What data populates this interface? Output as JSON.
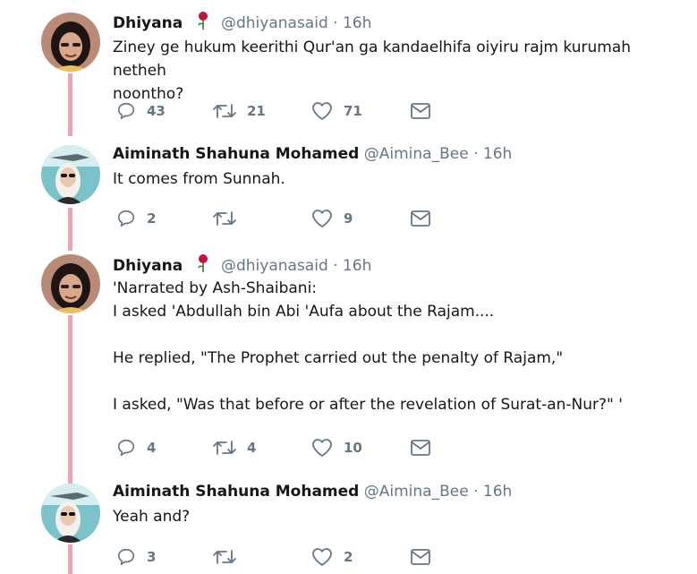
{
  "tweets": [
    {
      "name": "Dhiyana",
      "handle": "@dhiyanasaid",
      "time": "16h",
      "has_rose": true,
      "avatar_icon": "woman-portrait-icon",
      "lines": [
        "Ziney ge hukum keerithi Qur'an ga kandaelhifa oiyiru rajm kurumah netheh",
        "noontho?"
      ],
      "replies": "43",
      "retweets": "21",
      "likes": "71"
    },
    {
      "name": "Aiminath Shahuna Mohamed",
      "handle": "@Aimina_Bee",
      "time": "16h",
      "has_rose": false,
      "avatar_icon": "woman-sunglasses-icon",
      "lines": [
        "It comes from Sunnah."
      ],
      "replies": "2",
      "retweets": "",
      "likes": "9"
    },
    {
      "name": "Dhiyana",
      "handle": "@dhiyanasaid",
      "time": "16h",
      "has_rose": true,
      "avatar_icon": "woman-portrait-icon",
      "lines": [
        "'Narrated by Ash-Shaibani:",
        "I asked 'Abdullah bin Abi 'Aufa about the Rajam....",
        "",
        "He replied, \"The Prophet carried out the penalty of Rajam,\"",
        "",
        "I asked, \"Was that before or after the revelation of Surat-an-Nur?\" '"
      ],
      "replies": "4",
      "retweets": "4",
      "likes": "10"
    },
    {
      "name": "Aiminath Shahuna Mohamed",
      "handle": "@Aimina_Bee",
      "time": "16h",
      "has_rose": false,
      "avatar_icon": "woman-sunglasses-icon",
      "lines": [
        "Yeah and?"
      ],
      "replies": "3",
      "retweets": "",
      "likes": "2"
    }
  ],
  "separator": "·",
  "colors": {
    "thread_line": "#e6a9b3",
    "meta": "#657786",
    "text": "#14171a"
  }
}
